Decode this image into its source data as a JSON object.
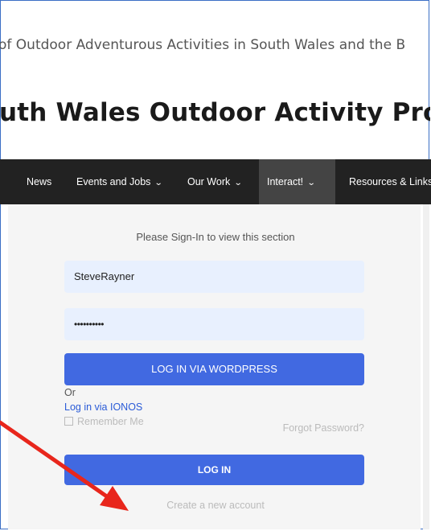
{
  "header": {
    "tagline": "of Outdoor Adventurous Activities in South Wales and the B",
    "site_title": "uth Wales Outdoor Activity Provi"
  },
  "nav": {
    "items": [
      {
        "label": "News"
      },
      {
        "label": "Events and Jobs"
      },
      {
        "label": "Our Work"
      },
      {
        "label": "Interact!"
      },
      {
        "label": "Resources & Links"
      }
    ]
  },
  "login": {
    "prompt": "Please Sign-In to view this section",
    "username_value": "SteveRayner",
    "password_value": "••••••••••",
    "wordpress_button": "LOG IN VIA WORDPRESS",
    "or_text": "Or",
    "ionos_link": "Log in via IONOS",
    "remember_label": "Remember Me",
    "forgot_link": "Forgot Password?",
    "login_button": "LOG IN",
    "create_account_link": "Create a new account"
  },
  "colors": {
    "accent": "#4169e1",
    "nav_bg": "#222222",
    "nav_active_bg": "#444444",
    "input_bg": "#e8f0fe",
    "annotation_arrow": "#e8261c"
  }
}
